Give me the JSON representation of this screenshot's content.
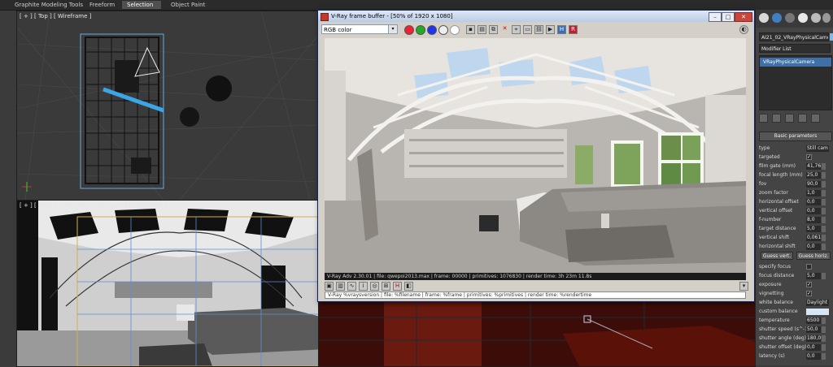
{
  "ribbon": {
    "tabs": [
      {
        "label": "Graphite Modeling Tools",
        "active": false
      },
      {
        "label": "Freeform",
        "active": false
      },
      {
        "label": "Selection",
        "active": true
      },
      {
        "label": "Object Paint",
        "active": false
      }
    ]
  },
  "viewports": {
    "top_label": "[ + ] [ Top ] [ Wireframe ]",
    "camera_label": "[ + ] [ AI21_02_VRayPhysicalCamera01 ] [ Shaded ]"
  },
  "vfb": {
    "title": "V-Ray frame buffer - [50% of 1920 x 1080]",
    "channel": "RGB color",
    "status_text": "V-Ray Adv 2.30.01 | file: qwepoi2013.max | frame: 00000 | primitives: 1076830 | render time: 3h 23m 11.8s",
    "stamp_text": "V-Ray %vraysversion | file: %filename | frame: %frame | primitives: %primitives | render time: %rendertime"
  },
  "command_panel": {
    "object_name": "AI21_02_VRayPhysicalCamera01",
    "modifier_list": "Modifier List",
    "stack_item": "VRayPhysicalCamera",
    "rollout_title": "Basic parameters",
    "params": [
      {
        "label": "type",
        "kind": "select",
        "value": "Still cam"
      },
      {
        "label": "targeted",
        "kind": "check",
        "value": "✓"
      },
      {
        "label": "film gate (mm)",
        "kind": "num",
        "value": "41,76"
      },
      {
        "label": "focal length (mm)",
        "kind": "num",
        "value": "25,0"
      },
      {
        "label": "fov",
        "kind": "num",
        "value": "90,0"
      },
      {
        "label": "zoom factor",
        "kind": "num",
        "value": "1,0"
      },
      {
        "label": "horizontal offset",
        "kind": "num",
        "value": "0,0"
      },
      {
        "label": "vertical offset",
        "kind": "num",
        "value": "0,0"
      },
      {
        "label": "f-number",
        "kind": "num",
        "value": "8,0"
      },
      {
        "label": "target distance",
        "kind": "num",
        "value": "5,0"
      },
      {
        "label": "vertical shift",
        "kind": "num",
        "value": "0,061"
      },
      {
        "label": "horizontal shift",
        "kind": "num",
        "value": "0,0"
      }
    ],
    "guess_vert": "Guess vert.",
    "guess_horiz": "Guess horiz.",
    "params2": [
      {
        "label": "specify focus",
        "kind": "check",
        "value": ""
      },
      {
        "label": "focus distance",
        "kind": "num",
        "value": "5,0"
      },
      {
        "label": "exposure",
        "kind": "check",
        "value": "✓"
      },
      {
        "label": "vignetting",
        "kind": "check",
        "value": "✓"
      },
      {
        "label": "white balance",
        "kind": "select",
        "value": "Daylight"
      },
      {
        "label": "custom balance",
        "kind": "color",
        "value": ""
      },
      {
        "label": "temperature",
        "kind": "num",
        "value": "6500"
      },
      {
        "label": "shutter speed (s^-1)",
        "kind": "num",
        "value": "50,0"
      },
      {
        "label": "shutter angle (deg)",
        "kind": "num",
        "value": "180,0"
      },
      {
        "label": "shutter offset (deg)",
        "kind": "num",
        "value": "0,0"
      },
      {
        "label": "latency (s)",
        "kind": "num",
        "value": "0,0"
      }
    ]
  }
}
